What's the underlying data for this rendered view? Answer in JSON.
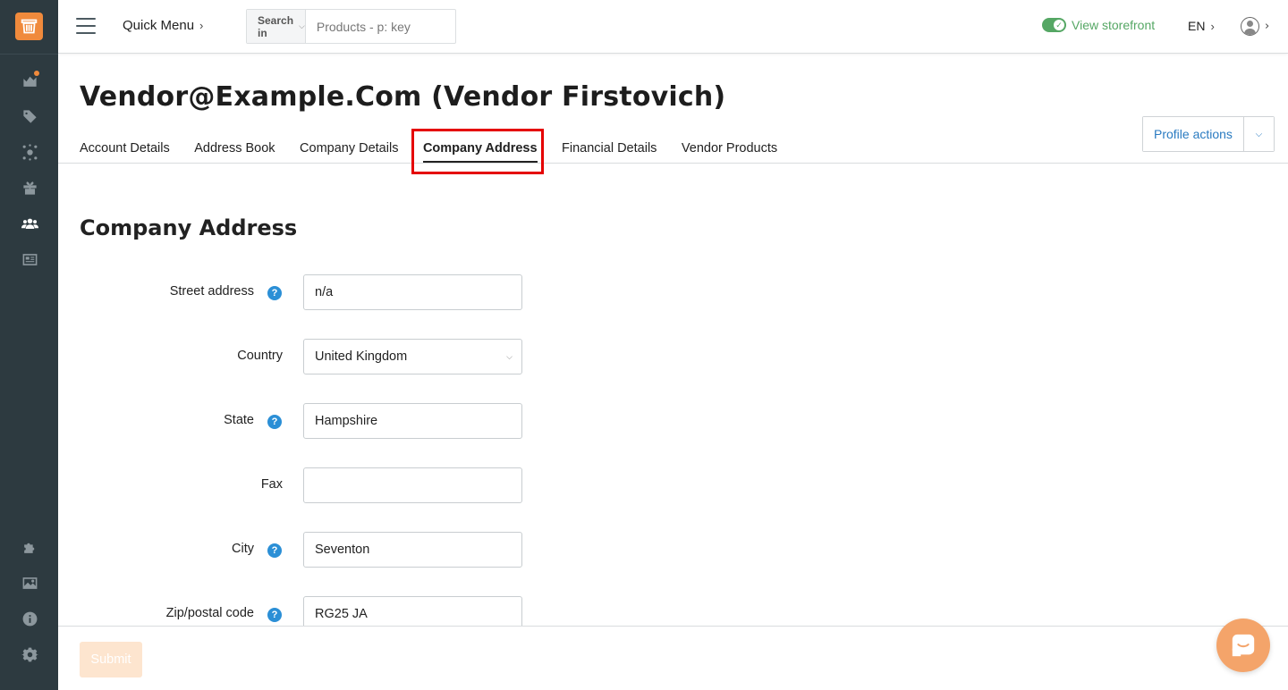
{
  "header": {
    "quick_menu": "Quick Menu",
    "search_in_label": "Search in",
    "search_placeholder": "Products - p: key",
    "storefront_label": "View storefront",
    "language": "EN"
  },
  "page": {
    "title": "Vendor@Example.Com (Vendor Firstovich)",
    "profile_actions": "Profile actions"
  },
  "tabs": [
    {
      "label": "Account Details",
      "active": false
    },
    {
      "label": "Address Book",
      "active": false
    },
    {
      "label": "Company Details",
      "active": false
    },
    {
      "label": "Company Address",
      "active": true
    },
    {
      "label": "Financial Details",
      "active": false
    },
    {
      "label": "Vendor Products",
      "active": false
    }
  ],
  "section": {
    "title": "Company Address",
    "fields": [
      {
        "label": "Street address",
        "value": "n/a",
        "help": true,
        "type": "text"
      },
      {
        "label": "Country",
        "value": "United Kingdom",
        "help": false,
        "type": "select"
      },
      {
        "label": "State",
        "value": "Hampshire",
        "help": true,
        "type": "text"
      },
      {
        "label": "Fax",
        "value": "",
        "help": false,
        "type": "text"
      },
      {
        "label": "City",
        "value": "Seventon",
        "help": true,
        "type": "text"
      },
      {
        "label": "Zip/postal code",
        "value": "RG25 JA",
        "help": true,
        "type": "text"
      }
    ]
  },
  "footer": {
    "submit_label": "Submit"
  },
  "colors": {
    "brand": "#f08a3c",
    "sidebar": "#2d3a40",
    "link": "#2a7bc1",
    "storefront": "#55a764",
    "help": "#2b8fd6",
    "highlight": "#e50000"
  },
  "icons": {
    "sidebar_top": [
      "dashboard-icon",
      "tags-icon",
      "network-icon",
      "gift-icon",
      "users-icon",
      "news-icon"
    ],
    "sidebar_bottom": [
      "puzzle-icon",
      "image-icon",
      "info-icon",
      "gear-icon"
    ]
  }
}
